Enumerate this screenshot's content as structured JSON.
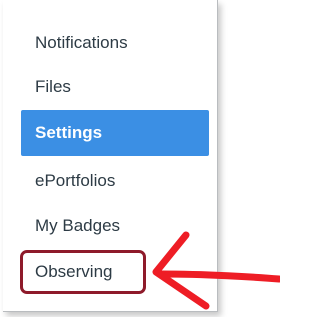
{
  "menu": {
    "items": [
      {
        "label": "Notifications",
        "active": false
      },
      {
        "label": "Files",
        "active": false
      },
      {
        "label": "Settings",
        "active": true
      },
      {
        "label": "ePortfolios",
        "active": false
      },
      {
        "label": "My Badges",
        "active": false
      },
      {
        "label": "Observing",
        "active": false
      }
    ]
  },
  "colors": {
    "active_background": "#3b8fe4",
    "text": "#2d3b45",
    "highlight_border": "#8e1a2a",
    "arrow": "#ee1d25"
  },
  "annotation": {
    "highlight_icon": "rounded-rectangle-outline",
    "arrow_icon": "hand-drawn-left-arrow"
  }
}
